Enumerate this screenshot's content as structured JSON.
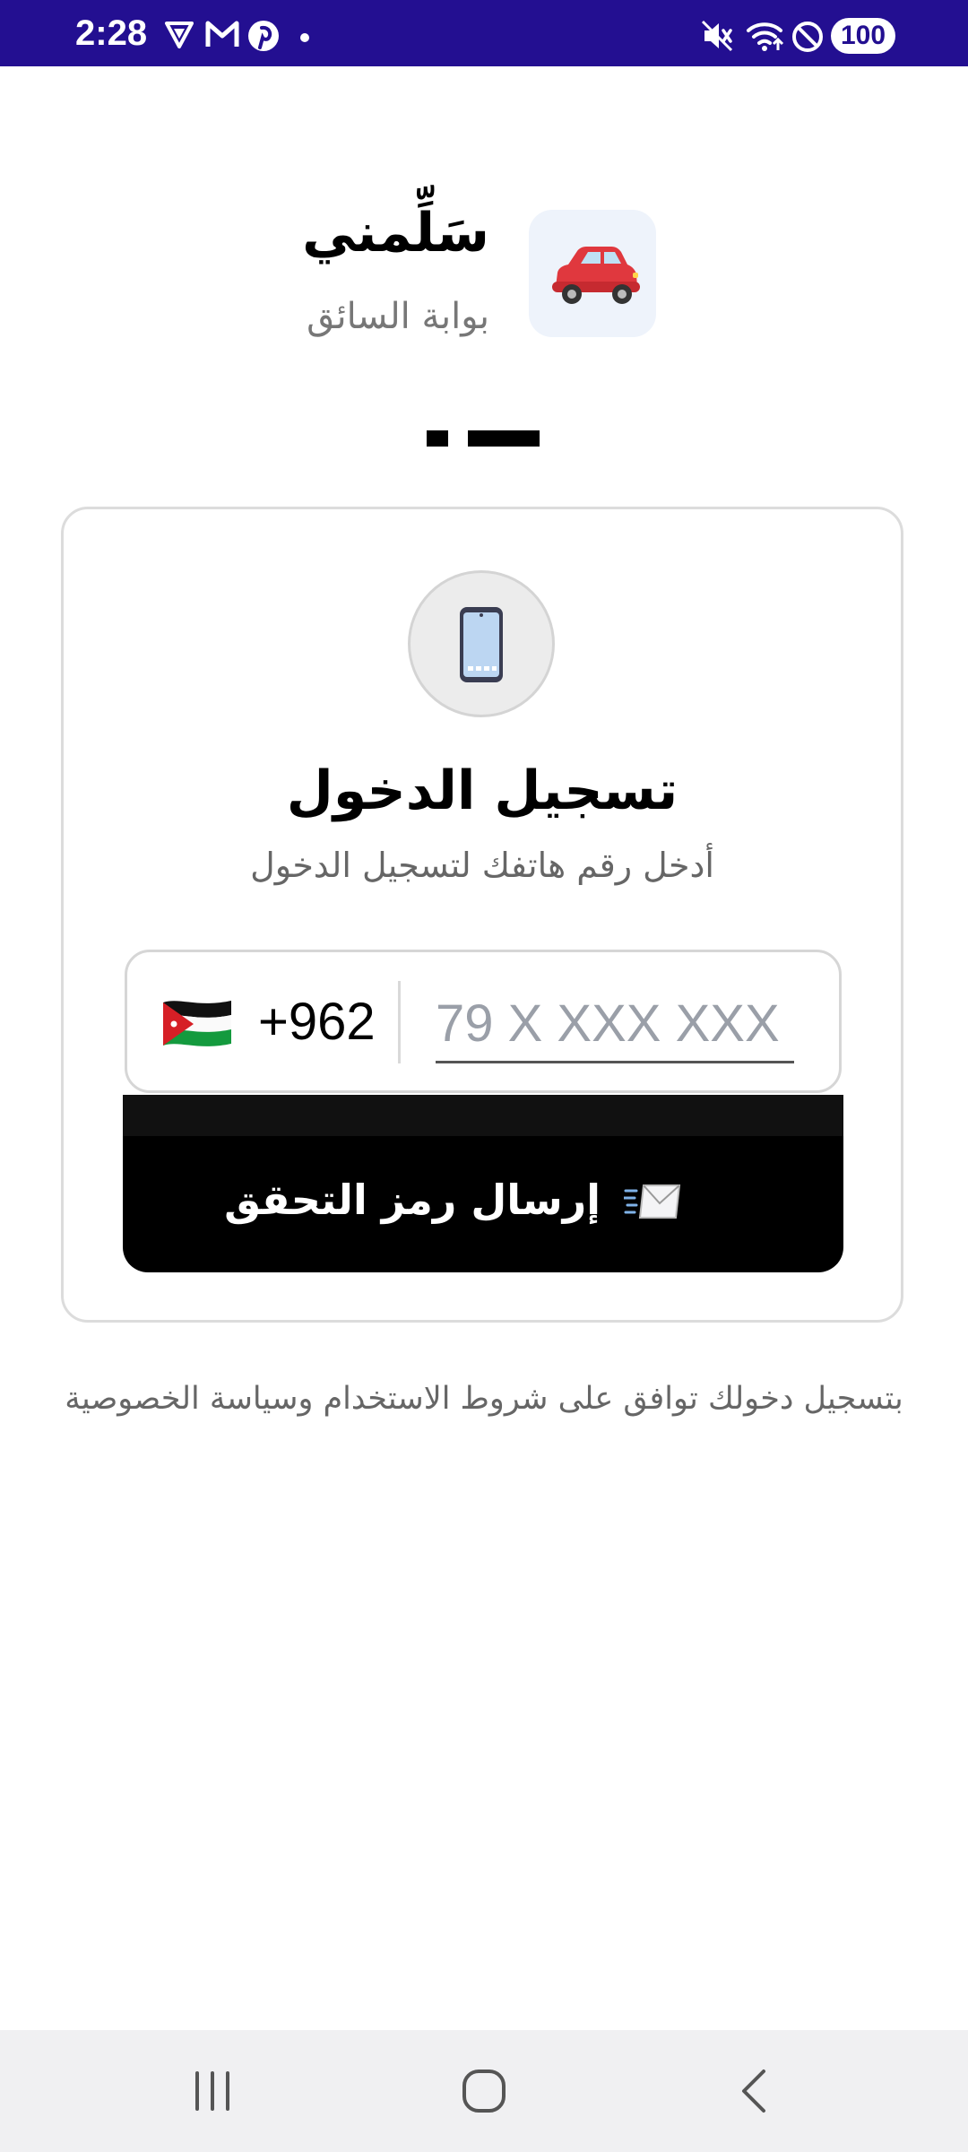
{
  "status_bar": {
    "time": "2:28",
    "battery": "100",
    "left_icons": [
      "vpn-shield-icon",
      "gmail-icon",
      "pinterest-icon",
      "notification-dot-icon"
    ],
    "right_icons": [
      "mute-icon",
      "wifi-icon",
      "do-not-disturb-icon",
      "battery-icon"
    ]
  },
  "header": {
    "app_name": "سَلِّمني",
    "subtitle": "بوابة السائق",
    "logo_icon": "car-icon"
  },
  "progress": {
    "total_steps": 2,
    "current_step": 2
  },
  "login": {
    "icon": "mobile-phone-icon",
    "title": "تسجيل الدخول",
    "subtitle": "أدخل رقم هاتفك لتسجيل الدخول",
    "country_flag": "jordan-flag-icon",
    "country_code": "+962",
    "phone_placeholder": "79 X XXX XXX",
    "phone_value": "",
    "send_button_label": "إرسال رمز التحقق",
    "send_button_icon": "envelope-icon"
  },
  "terms_text": "بتسجيل دخولك توافق على شروط الاستخدام وسياسة الخصوصية",
  "nav_bar": {
    "buttons": [
      "recent-apps-icon",
      "home-icon",
      "back-icon"
    ]
  },
  "colors": {
    "status_bar": "#230f91",
    "primary_button": "#000000",
    "logo_bg": "#eef3fb",
    "muted_text": "#666666",
    "nav_bar_bg": "#f0f0f2"
  }
}
